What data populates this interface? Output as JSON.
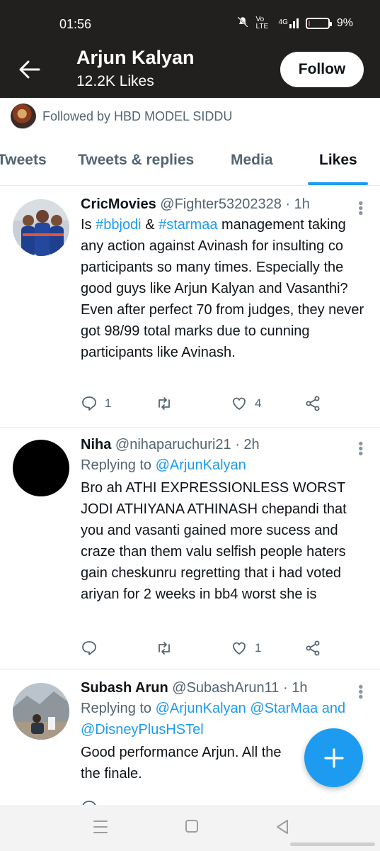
{
  "status_bar": {
    "time": "01:56",
    "network": "Vo LTE",
    "signal": "4G",
    "battery": "9%",
    "battery_level": 0.09
  },
  "header": {
    "title": "Arjun Kalyan",
    "subtitle": "12.2K Likes",
    "follow_label": "Follow"
  },
  "followed_by": "Followed by HBD MODEL SIDDU",
  "tabs": [
    {
      "label": "Tweets",
      "active": false
    },
    {
      "label": "Tweets & replies",
      "active": false
    },
    {
      "label": "Media",
      "active": false
    },
    {
      "label": "Likes",
      "active": true
    }
  ],
  "tweets": [
    {
      "name": "CricMovies",
      "handle": "@Fighter53202328",
      "time": "· 1h",
      "text_parts": [
        "Is ",
        "#bbjodi",
        " & ",
        "#starmaa",
        " management taking any action against Avinash for insulting co participants so many times. Especially the good guys like Arjun Kalyan and Vasanthi? Even after perfect 70 from judges, they never got 98/99 total marks due to cunning participants like Avinash."
      ],
      "replies": "1",
      "retweets": "",
      "likes": "4"
    },
    {
      "name": "Niha",
      "handle": "@nihaparuchuri21",
      "time": "· 2h",
      "reply_prefix": "Replying to ",
      "reply_to": "@ArjunKalyan",
      "text": "Bro ah ATHI EXPRESSIONLESS WORST JODI ATHIYANA ATHINASH chepandi that you and vasanti gained more sucess and craze than them valu selfish people haters gain cheskunru regretting that i had voted ariyan for 2 weeks in bb4 worst she is",
      "replies": "",
      "retweets": "",
      "likes": "1"
    },
    {
      "name": "Subash Arun",
      "handle": "@SubashArun11",
      "time": "· 1h",
      "reply_prefix": "Replying to ",
      "reply_to_1": "@ArjunKalyan @StarMaa",
      "reply_and": " and",
      "reply_to_2": "@DisneyPlusHSTel",
      "text": "Good performance Arjun. All the",
      "text_tail": "the finale."
    }
  ],
  "colors": {
    "header_bg": "#221f1f",
    "accent": "#1d9bf0",
    "muted": "#536471"
  },
  "fab_icon": "plus-icon",
  "nav": [
    "menu-icon",
    "home-square-icon",
    "back-triangle-icon"
  ]
}
